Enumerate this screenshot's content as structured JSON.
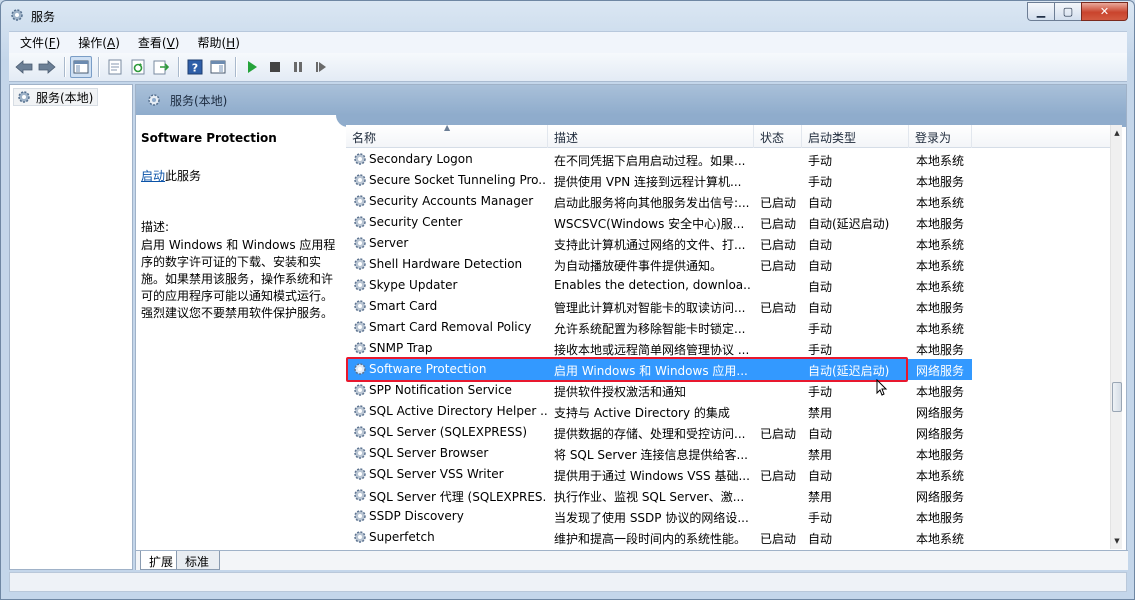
{
  "window": {
    "title": "服务"
  },
  "caption": {
    "minimize": "▁",
    "maximize": "▢",
    "close": "✕"
  },
  "menu": [
    {
      "text": "文件(",
      "key": "F",
      "end": ")"
    },
    {
      "text": "操作(",
      "key": "A",
      "end": ")"
    },
    {
      "text": "查看(",
      "key": "V",
      "end": ")"
    },
    {
      "text": "帮助(",
      "key": "H",
      "end": ")"
    }
  ],
  "toolbar": {
    "buttons": [
      "back-icon",
      "forward-icon",
      "show-hide-tree-icon",
      "properties-icon",
      "refresh-icon",
      "export-list-icon",
      "help-icon",
      "show-hide-action-pane-icon",
      "start-service-icon",
      "stop-service-icon",
      "pause-service-icon",
      "restart-service-icon"
    ]
  },
  "tree": {
    "root_label": "服务(本地)"
  },
  "main": {
    "header_label": "服务(本地)",
    "selected_service_title": "Software Protection",
    "start_link": "启动",
    "start_suffix": "此服务",
    "description_label": "描述:",
    "description_text": "启用 Windows 和 Windows 应用程序的数字许可证的下载、安装和实施。如果禁用该服务，操作系统和许可的应用程序可能以通知模式运行。强烈建议您不要禁用软件保护服务。"
  },
  "columns": {
    "name": "名称",
    "description": "描述",
    "status": "状态",
    "startup": "启动类型",
    "logon": "登录为"
  },
  "services": [
    {
      "name": "Secondary Logon",
      "description": "在不同凭据下启用启动过程。如果...",
      "status": "",
      "startup": "手动",
      "logon": "本地系统"
    },
    {
      "name": "Secure Socket Tunneling Pro...",
      "description": "提供使用 VPN 连接到远程计算机...",
      "status": "",
      "startup": "手动",
      "logon": "本地服务"
    },
    {
      "name": "Security Accounts Manager",
      "description": "启动此服务将向其他服务发出信号:...",
      "status": "已启动",
      "startup": "自动",
      "logon": "本地系统"
    },
    {
      "name": "Security Center",
      "description": "WSCSVC(Windows 安全中心)服...",
      "status": "已启动",
      "startup": "自动(延迟启动)",
      "logon": "本地服务"
    },
    {
      "name": "Server",
      "description": "支持此计算机通过网络的文件、打...",
      "status": "已启动",
      "startup": "自动",
      "logon": "本地系统"
    },
    {
      "name": "Shell Hardware Detection",
      "description": "为自动播放硬件事件提供通知。",
      "status": "已启动",
      "startup": "自动",
      "logon": "本地系统"
    },
    {
      "name": "Skype Updater",
      "description": "Enables the detection, downloa...",
      "status": "",
      "startup": "自动",
      "logon": "本地系统"
    },
    {
      "name": "Smart Card",
      "description": "管理此计算机对智能卡的取读访问...",
      "status": "已启动",
      "startup": "自动",
      "logon": "本地服务"
    },
    {
      "name": "Smart Card Removal Policy",
      "description": "允许系统配置为移除智能卡时锁定...",
      "status": "",
      "startup": "手动",
      "logon": "本地系统"
    },
    {
      "name": "SNMP Trap",
      "description": "接收本地或远程简单网络管理协议 ...",
      "status": "",
      "startup": "手动",
      "logon": "本地服务"
    },
    {
      "name": "Software Protection",
      "description": "启用 Windows 和 Windows 应用...",
      "status": "",
      "startup": "自动(延迟启动)",
      "logon": "网络服务"
    },
    {
      "name": "SPP Notification Service",
      "description": "提供软件授权激活和通知",
      "status": "",
      "startup": "手动",
      "logon": "本地服务"
    },
    {
      "name": "SQL Active Directory Helper ...",
      "description": "支持与 Active Directory 的集成",
      "status": "",
      "startup": "禁用",
      "logon": "网络服务"
    },
    {
      "name": "SQL Server (SQLEXPRESS)",
      "description": "提供数据的存储、处理和受控访问...",
      "status": "已启动",
      "startup": "自动",
      "logon": "网络服务"
    },
    {
      "name": "SQL Server Browser",
      "description": "将 SQL Server 连接信息提供给客...",
      "status": "",
      "startup": "禁用",
      "logon": "本地服务"
    },
    {
      "name": "SQL Server VSS Writer",
      "description": "提供用于通过 Windows VSS 基础...",
      "status": "已启动",
      "startup": "自动",
      "logon": "本地系统"
    },
    {
      "name": "SQL Server 代理 (SQLEXPRES...",
      "description": "执行作业、监视 SQL Server、激...",
      "status": "",
      "startup": "禁用",
      "logon": "网络服务"
    },
    {
      "name": "SSDP Discovery",
      "description": "当发现了使用 SSDP 协议的网络设...",
      "status": "",
      "startup": "手动",
      "logon": "本地服务"
    },
    {
      "name": "Superfetch",
      "description": "维护和提高一段时间内的系统性能。",
      "status": "已启动",
      "startup": "自动",
      "logon": "本地系统"
    }
  ],
  "selected_index": 10,
  "tabs": {
    "extended": "扩展",
    "standard": "标准"
  },
  "colors": {
    "selection": "#3399ff",
    "highlight_border": "#e8182e",
    "link": "#0b53a8"
  }
}
